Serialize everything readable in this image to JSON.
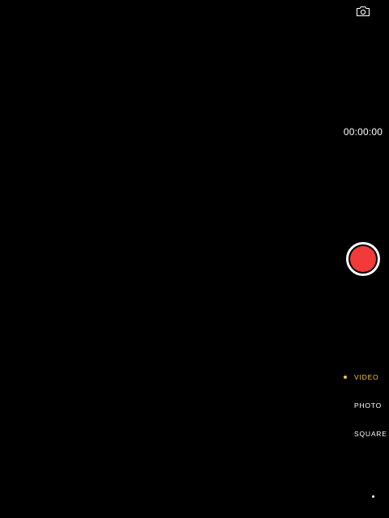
{
  "camera": {
    "switch_icon": "camera-switch-icon",
    "timer": "00:00:00",
    "record_color": "#f23a3a",
    "accent_color": "#f5c64a",
    "modes": [
      {
        "label": "VIDEO",
        "active": true
      },
      {
        "label": "PHOTO",
        "active": false
      },
      {
        "label": "SQUARE",
        "active": false
      }
    ]
  }
}
